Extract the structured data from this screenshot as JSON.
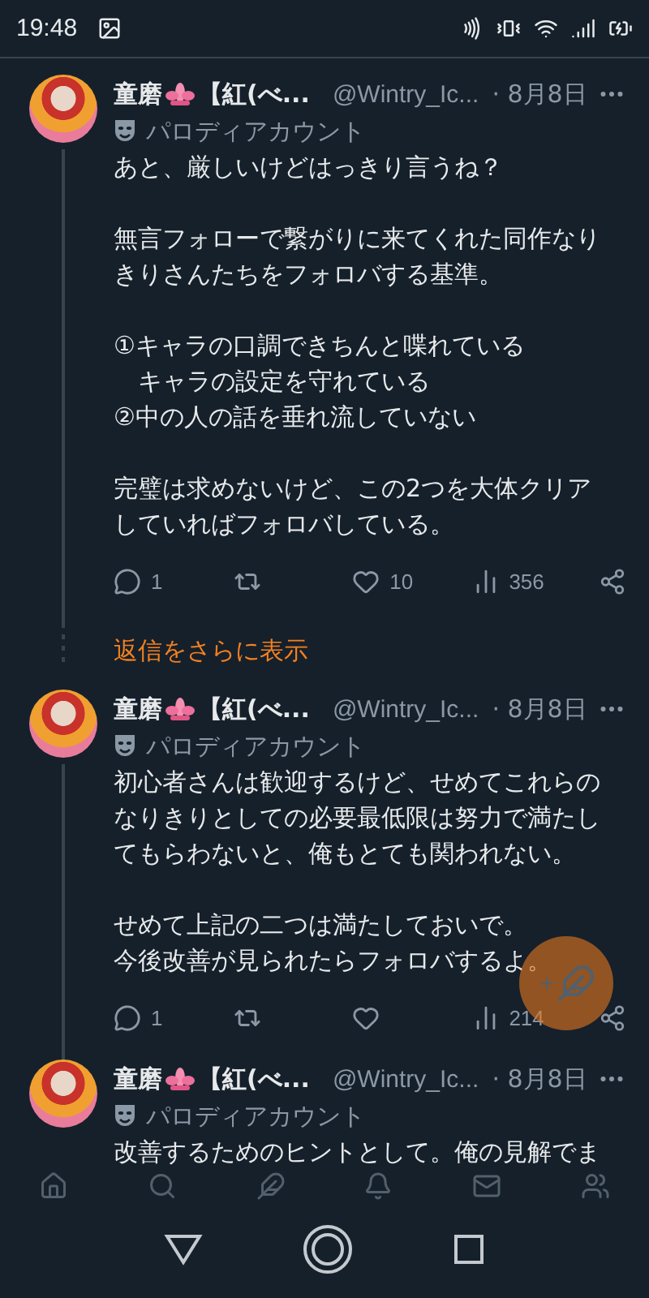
{
  "status_bar": {
    "time": "19:48"
  },
  "tweets": [
    {
      "name": "童磨",
      "name_rest": "【紅(べ...",
      "handle": "@Wintry_Ic...",
      "date": "· 8月8日",
      "label": "パロディアカウント",
      "thread_below": true,
      "paragraphs": [
        [
          "あと、厳しいけどはっきり言うね？"
        ],
        [
          "無言フォローで繋がりに来てくれた同作なり",
          "きりさんたちをフォロバする基準。"
        ],
        [
          "①キャラの口調できちんと喋れている",
          "　キャラの設定を守れている",
          "②中の人の話を垂れ流していない"
        ],
        [
          "完璧は求めないけど、この2つを大体クリア",
          "していればフォロバしている。"
        ]
      ],
      "actions": [
        {
          "kind": "reply",
          "count": "1"
        },
        {
          "kind": "retweet"
        },
        {
          "kind": "like",
          "count": "10"
        },
        {
          "kind": "views",
          "count": "356"
        },
        {
          "kind": "share"
        }
      ],
      "show_more": "返信をさらに表示"
    },
    {
      "name": "童磨",
      "name_rest": "【紅(べ...",
      "handle": "@Wintry_Ic...",
      "date": "· 8月8日",
      "label": "パロディアカウント",
      "thread_below": true,
      "paragraphs": [
        [
          "初心者さんは歓迎するけど、せめてこれらの",
          "なりきりとしての必要最低限は努力で満たし",
          "てもらわないと、俺もとても関われない。"
        ],
        [
          "せめて上記の二つは満たしておいで。",
          "今後改善が見られたらフォロバするよ。"
        ]
      ],
      "actions": [
        {
          "kind": "reply",
          "count": "1"
        },
        {
          "kind": "retweet"
        },
        {
          "kind": "like"
        },
        {
          "kind": "views",
          "count": "214"
        },
        {
          "kind": "share"
        }
      ]
    },
    {
      "name": "童磨",
      "name_rest": "【紅(べ...",
      "handle": "@Wintry_Ic...",
      "date": "· 8月8日",
      "label": "パロディアカウント",
      "thread_below": false,
      "paragraphs": [
        [
          "改善するためのヒントとして。俺の見解でま"
        ]
      ]
    }
  ]
}
